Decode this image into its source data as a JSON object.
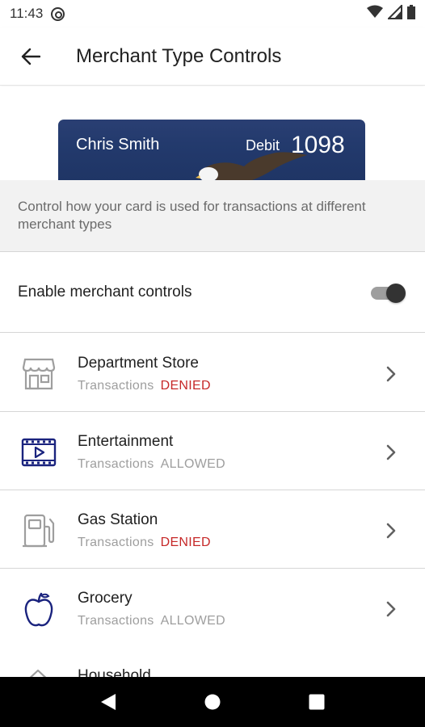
{
  "status_bar": {
    "time": "11:43"
  },
  "app_bar": {
    "title": "Merchant Type Controls"
  },
  "card": {
    "holder": "Chris Smith",
    "type": "Debit",
    "last_digits": "1098"
  },
  "info": {
    "text": "Control how your card is used for transactions at different merchant types"
  },
  "enable_controls": {
    "label": "Enable merchant controls",
    "enabled": true
  },
  "merchants": [
    {
      "name": "Department Store",
      "label": "Transactions",
      "status": "DENIED",
      "icon": "storefront-icon"
    },
    {
      "name": "Entertainment",
      "label": "Transactions",
      "status": "ALLOWED",
      "icon": "film-icon"
    },
    {
      "name": "Gas Station",
      "label": "Transactions",
      "status": "DENIED",
      "icon": "gas-pump-icon"
    },
    {
      "name": "Grocery",
      "label": "Transactions",
      "status": "ALLOWED",
      "icon": "apple-icon"
    },
    {
      "name": "Household",
      "icon": "house-icon"
    }
  ],
  "colors": {
    "denied": "#c62828",
    "icon_active": "#1a237e",
    "icon_muted": "#9e9e9e"
  }
}
